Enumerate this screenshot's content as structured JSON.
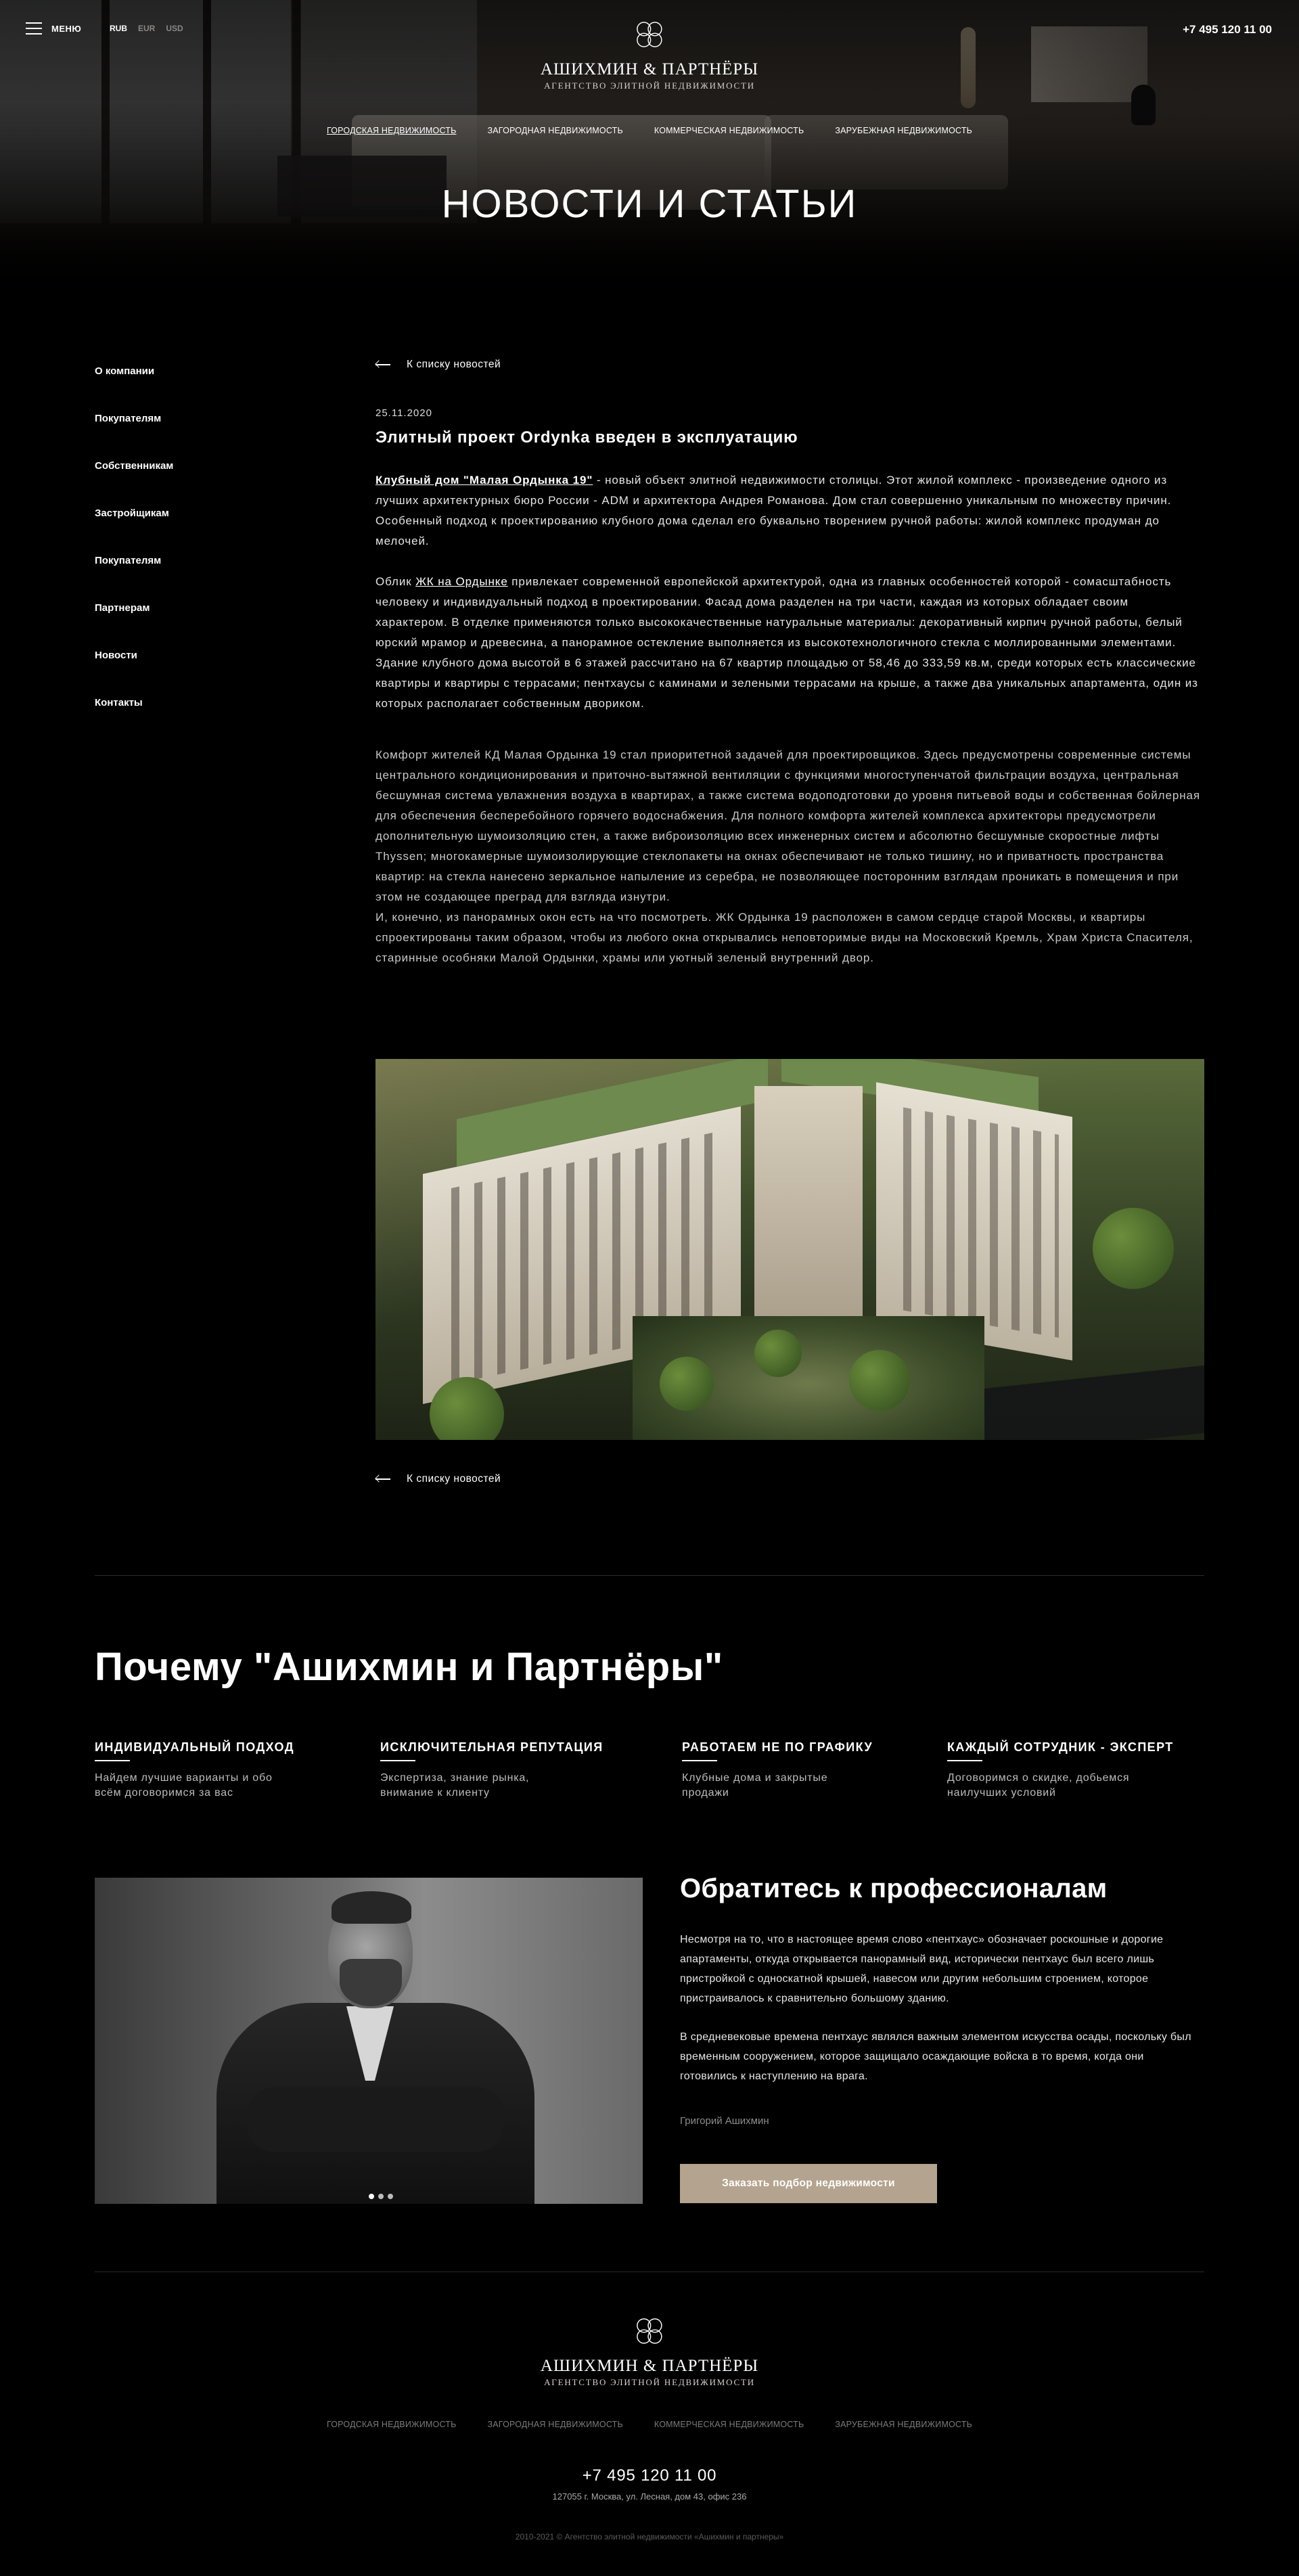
{
  "header": {
    "menu_label": "МЕНЮ",
    "currencies": [
      {
        "label": "RUB",
        "active": true
      },
      {
        "label": "EUR",
        "active": false
      },
      {
        "label": "USD",
        "active": false
      }
    ],
    "phone": "+7 495 120 11 00"
  },
  "logo": {
    "brand": "АШИХМИН & ПАРТНЁРЫ",
    "tagline": "АГЕНТСТВО ЭЛИТНОЙ НЕДВИЖИМОСТИ",
    "icon": "quatrefoil-logo-icon"
  },
  "categories": [
    "ГОРОДСКАЯ НЕДВИЖИМОСТЬ",
    "ЗАГОРОДНАЯ НЕДВИЖИМОСТЬ",
    "КОММЕРЧЕСКАЯ НЕДВИЖИМОСТЬ",
    "ЗАРУБЕЖНАЯ НЕДВИЖИМОСТЬ"
  ],
  "hero": {
    "title": "НОВОСТИ И СТАТЬИ"
  },
  "sidenav": [
    "О компании",
    "Покупателям",
    "Собственникам",
    "Застройщикам",
    "Покупателям",
    "Партнерам",
    "Новости",
    "Контакты"
  ],
  "article": {
    "back_label": "К списку новостей",
    "date": "25.11.2020",
    "title": "Элитный проект Ordynka введен в эксплуатацию",
    "p1_link": "Клубный дом \"Малая Ордынка 19\"",
    "p1_rest": " - новый объект элитной недвижимости столицы. Этот жилой комплекс - произведение одного из лучших архитектурных бюро России - ADM и архитектора Андрея Романова. Дом стал совершенно уникальным по множеству причин. Особенный подход к проектированию клубного дома сделал его буквально творением ручной работы: жилой комплекс продуман до мелочей.",
    "p2_pre": "Облик ",
    "p2_link": "ЖК на Ордынке",
    "p2_rest": " привлекает современной европейской архитектурой, одна из главных особенностей которой - сомасштабность человеку и индивидуальный подход в проектировании. Фасад дома разделен на три части, каждая из которых обладает своим характером. В отделке применяются только высококачественные натуральные материалы: декоративный кирпич ручной работы, белый юрский мрамор и древесина, а панорамное остекление выполняется из высокотехнологичного стекла с моллированными элементами.",
    "p3": "Здание клубного дома высотой в 6 этажей рассчитано на 67 квартир площадью от 58,46 до 333,59 кв.м, среди которых есть классические квартиры и квартиры с террасами; пентхаусы с каминами и зелеными террасами на крыше, а также два уникальных апартамента, один из которых располагает собственным двориком.",
    "p4": "Комфорт жителей КД Малая Ордынка 19 стал приоритетной задачей для проектировщиков. Здесь предусмотрены современные системы центрального кондиционирования и приточно-вытяжной вентиляции с функциями многоступенчатой фильтрации воздуха, центральная бесшумная система увлажнения воздуха в квартирах, а также система водоподготовки до уровня питьевой воды и собственная бойлерная для обеспечения бесперебойного горячего водоснабжения. Для полного комфорта жителей комплекса архитекторы предусмотрели дополнительную шумоизоляцию стен, а также виброизоляцию всех инженерных систем и абсолютно бесшумные скоростные лифты Thyssen; многокамерные шумоизолирующие стеклопакеты на окнах обеспечивают не только тишину, но и приватность пространства квартир: на стекла нанесено зеркальное напыление из серебра, не позволяющее посторонним взглядам проникать в помещения и при этом не создающее преград для взгляда изнутри.",
    "p5": "И, конечно, из панорамных окон есть на что посмотреть. ЖК Ордынка 19 расположен в самом сердце старой Москвы, и квартиры спроектированы таким образом, чтобы из любого окна открывались неповторимые виды на Московский Кремль, Храм Христа Спасителя, старинные особняки Малой Ордынки, храмы или уютный зеленый внутренний двор."
  },
  "why": {
    "title": "Почему \"Ашихмин и Партнёры\"",
    "features": [
      {
        "title": "ИНДИВИДУАЛЬНЫЙ ПОДХОД",
        "line1": "Найдем лучшие варианты и обо",
        "line2": "всём договоримся за вас"
      },
      {
        "title": "ИСКЛЮЧИТЕЛЬНАЯ РЕПУТАЦИЯ",
        "line1": "Экспертиза, знание рынка,",
        "line2": "внимание к клиенту"
      },
      {
        "title": "РАБОТАЕМ НЕ ПО ГРАФИКУ",
        "line1": "Клубные дома и закрытые",
        "line2": "продажи"
      },
      {
        "title": "КАЖДЫЙ СОТРУДНИК - ЭКСПЕРТ",
        "line1": "Договоримся о скидке, добьемся",
        "line2": "наилучших условий"
      }
    ]
  },
  "contact": {
    "title": "Обратитесь к профессионалам",
    "p1": "Несмотря на то, что в настоящее время слово «пентхаус» обозначает роскошные и дорогие апартаменты, откуда открывается панорамный вид, исторически пентхаус был всего лишь пристройкой с односкатной крышей, навесом или другим небольшим строением, которое пристраивалось к сравнительно большому зданию.",
    "p2": "В средневековые времена пентхаус являлся важным элементом искусства осады, поскольку был временным сооружением, которое защищало осаждающие войска в то время, когда они готовились к наступлению на врага.",
    "signature": "Григорий Ашихмин",
    "cta": "Заказать подбор недвижимости",
    "slides_active": 0
  },
  "footer": {
    "phone": "+7 495 120 11 00",
    "address": "127055 г. Москва, ул. Лесная, дом 43, офис 236",
    "copyright": "2010-2021 © Агентство элитной недвижимости «Ашихмин и партнеры»"
  },
  "colors": {
    "background": "#000000",
    "accent": "#b4a38e",
    "text": "#ffffff",
    "muted": "#8d8d8d"
  }
}
